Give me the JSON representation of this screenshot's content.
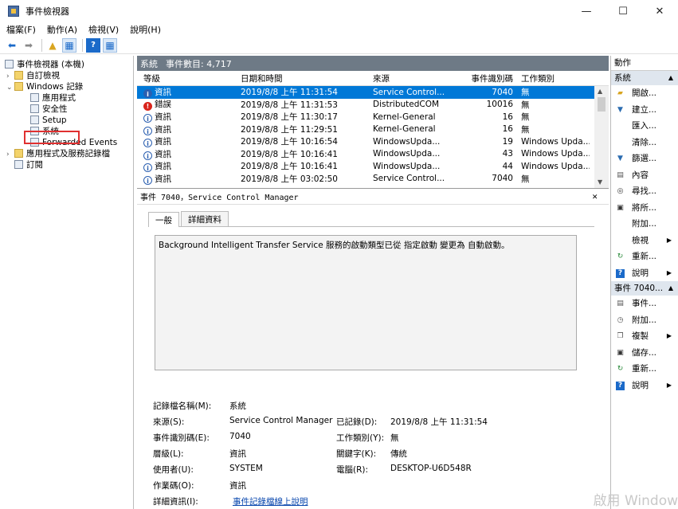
{
  "window": {
    "title": "事件檢視器",
    "minimize": "—",
    "maximize": "☐",
    "close": "✕"
  },
  "menu": [
    "檔案(F)",
    "動作(A)",
    "檢視(V)",
    "說明(H)"
  ],
  "tree": [
    {
      "label": "事件檢視器 (本機)",
      "arrow": "",
      "indent": 0
    },
    {
      "label": "自訂檢視",
      "arrow": "›",
      "indent": 1
    },
    {
      "label": "Windows 記錄",
      "arrow": "⌄",
      "indent": 1
    },
    {
      "label": "應用程式",
      "arrow": "",
      "indent": 2
    },
    {
      "label": "安全性",
      "arrow": "",
      "indent": 2
    },
    {
      "label": "Setup",
      "arrow": "",
      "indent": 2
    },
    {
      "label": "系統",
      "arrow": "",
      "indent": 2
    },
    {
      "label": "Forwarded Events",
      "arrow": "",
      "indent": 2
    },
    {
      "label": "應用程式及服務記錄檔",
      "arrow": "›",
      "indent": 1
    },
    {
      "label": "訂閱",
      "arrow": "",
      "indent": 1
    }
  ],
  "log": {
    "name": "系統",
    "count_label": "事件數目: 4,717"
  },
  "columns": [
    "等級",
    "日期和時間",
    "來源",
    "事件識別碼",
    "工作類別"
  ],
  "events": [
    {
      "level": "資訊",
      "type": "info",
      "date": "2019/8/8 上午 11:31:54",
      "source": "Service Control...",
      "id": "7040",
      "task": "無"
    },
    {
      "level": "錯誤",
      "type": "err",
      "date": "2019/8/8 上午 11:31:53",
      "source": "DistributedCOM",
      "id": "10016",
      "task": "無"
    },
    {
      "level": "資訊",
      "type": "info",
      "date": "2019/8/8 上午 11:30:17",
      "source": "Kernel-General",
      "id": "16",
      "task": "無"
    },
    {
      "level": "資訊",
      "type": "info",
      "date": "2019/8/8 上午 11:29:51",
      "source": "Kernel-General",
      "id": "16",
      "task": "無"
    },
    {
      "level": "資訊",
      "type": "info",
      "date": "2019/8/8 上午 10:16:54",
      "source": "WindowsUpda...",
      "id": "19",
      "task": "Windows Upda..."
    },
    {
      "level": "資訊",
      "type": "info",
      "date": "2019/8/8 上午 10:16:41",
      "source": "WindowsUpda...",
      "id": "43",
      "task": "Windows Upda..."
    },
    {
      "level": "資訊",
      "type": "info",
      "date": "2019/8/8 上午 10:16:41",
      "source": "WindowsUpda...",
      "id": "44",
      "task": "Windows Upda..."
    },
    {
      "level": "資訊",
      "type": "info",
      "date": "2019/8/8 上午 03:02:50",
      "source": "Service Control...",
      "id": "7040",
      "task": "無"
    }
  ],
  "detail": {
    "header": "事件 7040，Service Control Manager",
    "tabs": [
      "一般",
      "詳細資料"
    ],
    "description": "Background Intelligent Transfer Service 服務的啟動類型已從 指定啟動 變更為 自動啟動。",
    "props": {
      "logname_label": "記錄檔名稱(M):",
      "logname": "系統",
      "source_label": "來源(S):",
      "source": "Service Control Manager",
      "logged_label": "已記錄(D):",
      "logged": "2019/8/8 上午 11:31:54",
      "eventid_label": "事件識別碼(E):",
      "eventid": "7040",
      "task_label": "工作類別(Y):",
      "task": "無",
      "level_label": "層級(L):",
      "level": "資訊",
      "keywords_label": "關鍵字(K):",
      "keywords": "傳統",
      "user_label": "使用者(U):",
      "user": "SYSTEM",
      "computer_label": "電腦(R):",
      "computer": "DESKTOP-U6D548R",
      "opcode_label": "作業碼(O):",
      "opcode": "資訊",
      "moreinfo_label": "詳細資訊(I):",
      "moreinfo": "事件記錄檔線上說明"
    }
  },
  "actions": {
    "title": "動作",
    "section1": "系統",
    "items1": [
      {
        "label": "開啟...",
        "icon": "folder-icon"
      },
      {
        "label": "建立...",
        "icon": "filter-icon"
      },
      {
        "label": "匯入...",
        "icon": ""
      },
      {
        "label": "清除...",
        "icon": ""
      },
      {
        "label": "篩選...",
        "icon": "filter-icon"
      },
      {
        "label": "內容",
        "icon": "properties-icon"
      },
      {
        "label": "尋找...",
        "icon": "binoculars-icon"
      },
      {
        "label": "將所...",
        "icon": "save-icon"
      },
      {
        "label": "附加...",
        "icon": ""
      },
      {
        "label": "檢視",
        "icon": "",
        "submenu": true
      },
      {
        "label": "重新...",
        "icon": "refresh-icon"
      },
      {
        "label": "說明",
        "icon": "help-icon",
        "submenu": true
      }
    ],
    "section2": "事件 7040...",
    "items2": [
      {
        "label": "事件...",
        "icon": "properties-icon"
      },
      {
        "label": "附加...",
        "icon": "task-icon"
      },
      {
        "label": "複製",
        "icon": "copy-icon",
        "submenu": true
      },
      {
        "label": "儲存...",
        "icon": "save-icon"
      },
      {
        "label": "重新...",
        "icon": "refresh-icon"
      },
      {
        "label": "說明",
        "icon": "help-icon",
        "submenu": true
      }
    ]
  },
  "watermark": "啟用 Window"
}
